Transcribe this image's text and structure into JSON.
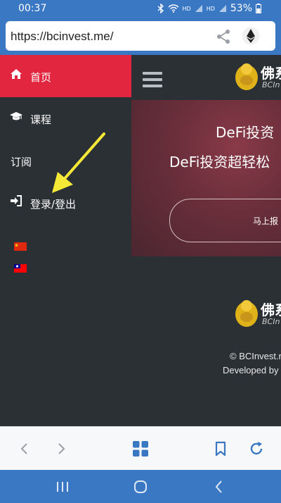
{
  "status_bar": {
    "time": "00:37",
    "network_label_1": "HD",
    "network_label_2": "HD",
    "battery": "53%"
  },
  "browser": {
    "url": "https://bcinvest.me/",
    "share_icon": "share-icon",
    "wallet_icon": "ethereum-icon"
  },
  "sidebar": {
    "items": [
      {
        "label": "首页",
        "icon": "home-icon",
        "active": true
      },
      {
        "label": "课程",
        "icon": "graduation-cap-icon",
        "active": false
      },
      {
        "label": "订阅",
        "icon": "",
        "active": false
      },
      {
        "label": "登录/登出",
        "icon": "sign-in-icon",
        "active": false
      }
    ],
    "languages": [
      {
        "icon": "china-flag-icon"
      },
      {
        "icon": "taiwan-flag-icon"
      }
    ]
  },
  "main": {
    "menu_icon": "hamburger-menu-icon",
    "logo_text": "佛系",
    "logo_sub": "BCIn",
    "hero": {
      "title": "DeFi投资",
      "subtitle": "DeFi投资超轻松",
      "button_label": "马上报"
    },
    "footer": {
      "copyright": "© BCInvest.r",
      "developed_by": "Developed by"
    }
  },
  "toolbar": {
    "back_icon": "chevron-left-icon",
    "forward_icon": "chevron-right-icon",
    "tabs_icon": "tabs-grid-icon",
    "bookmark_icon": "bookmark-icon",
    "reload_icon": "reload-icon"
  },
  "android_nav": {
    "recents_icon": "recents-icon",
    "home_icon": "home-circle-icon",
    "back_icon": "back-icon"
  },
  "colors": {
    "accent": "#3b78c4",
    "active_nav": "#e3263f",
    "sidebar_bg": "#2b3035",
    "annotation_arrow": "#f5e836"
  }
}
